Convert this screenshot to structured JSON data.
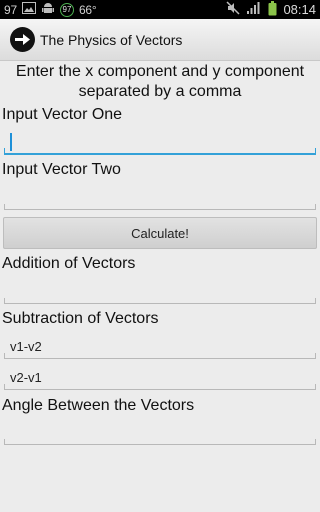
{
  "status_bar": {
    "notification_count": "97",
    "battery_circle_value": "97",
    "temperature": "66°",
    "time": "08:14"
  },
  "app": {
    "title": "The Physics of Vectors"
  },
  "form": {
    "instructions": "Enter the x component and y component separated by a comma",
    "vector_one_label": "Input Vector One",
    "vector_one_value": "",
    "vector_two_label": "Input Vector Two",
    "vector_two_value": "",
    "calculate_label": "Calculate!",
    "addition_label": "Addition of Vectors",
    "addition_value": "",
    "subtraction_label": "Subtraction of Vectors",
    "v1_minus_v2_value": "v1-v2",
    "v2_minus_v1_value": "v2-v1",
    "angle_label": "Angle Between the Vectors",
    "angle_value": ""
  },
  "colors": {
    "focus_accent": "#33a1d8",
    "background": "#ececec"
  }
}
